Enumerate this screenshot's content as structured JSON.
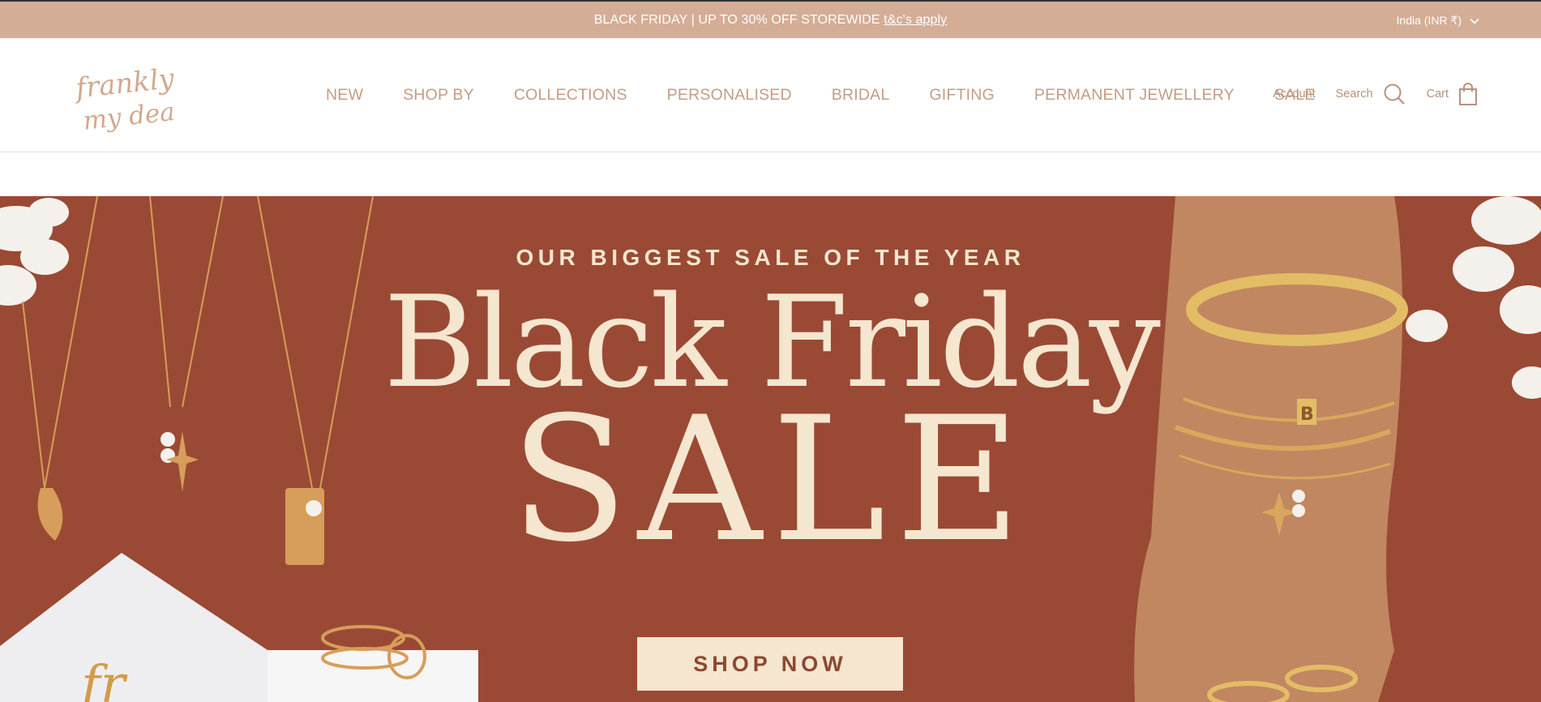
{
  "announcement": {
    "message": "BLACK FRIDAY | UP TO 30% OFF STOREWIDE",
    "link": "t&c's apply",
    "country": "India (INR ₹)"
  },
  "header": {
    "logo_line1": "frankly",
    "logo_line2": "my dear",
    "nav": [
      "NEW",
      "SHOP BY",
      "COLLECTIONS",
      "PERSONALISED",
      "BRIDAL",
      "GIFTING",
      "PERMANENT JEWELLERY",
      "SALE"
    ],
    "account": "Account",
    "search": "Search",
    "cart": "Cart"
  },
  "hero": {
    "kicker": "OUR BIGGEST SALE OF THE YEAR",
    "title_line1": "Black Friday",
    "title_line2": "SALE",
    "cta": "SHOP NOW",
    "bracelet_initial": "B"
  },
  "colors": {
    "announcement_bg": "#d4ad96",
    "hero_bg": "#9a4a34",
    "hero_text": "#f5e6cf",
    "nav_text": "#c29d86"
  }
}
